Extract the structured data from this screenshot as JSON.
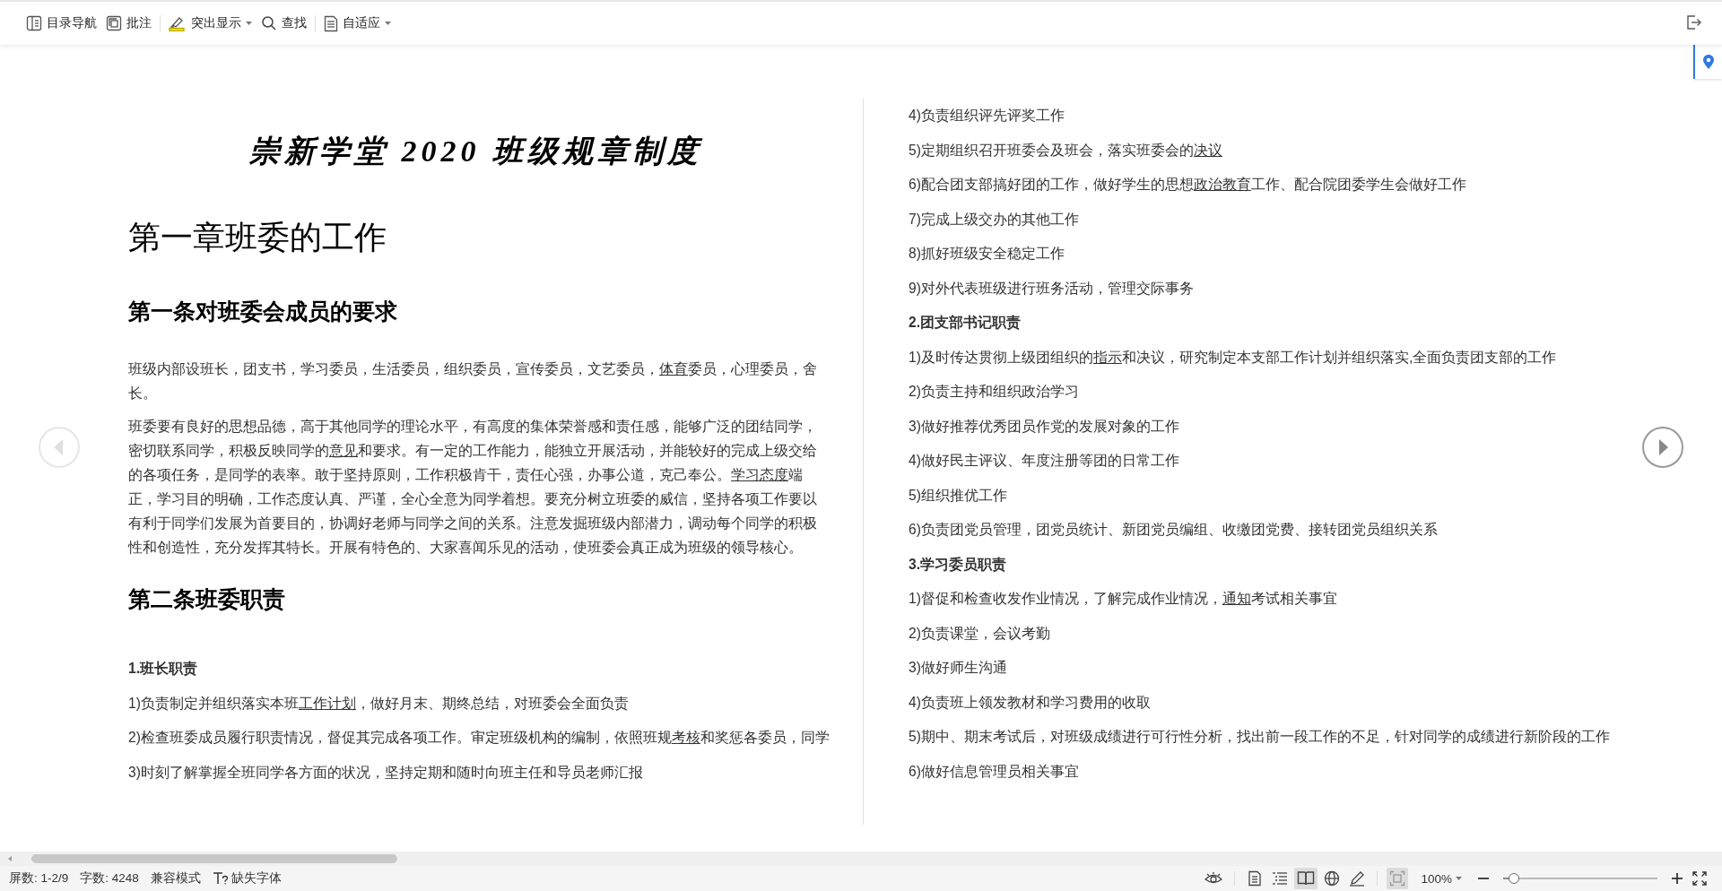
{
  "toolbar": {
    "groups": [
      [
        {
          "kind": "nav",
          "label": "目录导航",
          "dropdown": false
        },
        {
          "kind": "comment",
          "label": "批注",
          "dropdown": false
        }
      ],
      [
        {
          "kind": "highlight",
          "label": "突出显示",
          "dropdown": true
        },
        {
          "kind": "search",
          "label": "查找",
          "dropdown": false
        }
      ],
      [
        {
          "kind": "fit",
          "label": "自适应",
          "dropdown": true
        }
      ]
    ]
  },
  "left_page": {
    "blocks": [
      {
        "kind": "title",
        "runs": [
          {
            "text": "崇新学堂 2020 班级规章制度",
            "underline": false
          }
        ]
      },
      {
        "kind": "chapter",
        "runs": [
          {
            "text": "第一章班委的工作",
            "underline": false
          }
        ]
      },
      {
        "kind": "section",
        "runs": [
          {
            "text": "第一条对班委会成员的要求",
            "underline": false
          }
        ]
      },
      {
        "kind": "para",
        "runs": [
          {
            "text": "班级内部设班长，团支书，学习委员，生活委员，组织委员，宣传委员，文艺委员，",
            "underline": false
          },
          {
            "text": "体育",
            "underline": true
          },
          {
            "text": "委员，心理委员，舍长。",
            "underline": false
          }
        ]
      },
      {
        "kind": "para",
        "runs": [
          {
            "text": "班委要有良好的思想品德，高于其他同学的理论水平，有高度的集体荣誉感和责任感，能够广泛的团结同学，密切联系同学，积极反映同学的",
            "underline": false
          },
          {
            "text": "意见",
            "underline": true
          },
          {
            "text": "和要求。有一定的工作能力，能独立开展活动，并能较好的完成上级交给的各项任务，是同学的表率。敢于坚持原则，工作积极肯干，责任心强，办事公道，克己奉公。",
            "underline": false
          },
          {
            "text": "学习态度",
            "underline": true
          },
          {
            "text": "端正，学习目的明确，工作态度认真、严谨，全心全意为同学着想。要充分树立班委的威信，坚持各项工作要以有利于同学们发展为首要目的，协调好老师与同学之间的关系。注意发掘班级内部潜力，调动每个同学的积极性和创造性，充分发挥其特长。开展有特色的、大家喜闻乐见的活动，使班委会真正成为班级的领导核心。",
            "underline": false
          }
        ]
      },
      {
        "kind": "section",
        "runs": [
          {
            "text": "第二条班委职责",
            "underline": false
          }
        ]
      },
      {
        "kind": "subhead",
        "runs": [
          {
            "text": "1.班长职责",
            "underline": false
          }
        ]
      },
      {
        "kind": "item",
        "runs": [
          {
            "text": "1)负责制定并组织落实本班",
            "underline": false
          },
          {
            "text": "工作计划",
            "underline": true
          },
          {
            "text": "，做好月末、期终总结，对班委会全面负责",
            "underline": false
          }
        ]
      },
      {
        "kind": "item",
        "runs": [
          {
            "text": "2)检查班委成员履行职责情况，督促其完成各项工作。审定班级机构的编制，依照班规",
            "underline": false
          },
          {
            "text": "考核",
            "underline": true
          },
          {
            "text": "和奖惩各委员，同学",
            "underline": false
          }
        ]
      },
      {
        "kind": "item",
        "runs": [
          {
            "text": "3)时刻了解掌握全班同学各方面的状况，坚持定期和随时向班主任和导员老师汇报",
            "underline": false
          }
        ]
      }
    ]
  },
  "right_page": {
    "blocks": [
      {
        "kind": "item",
        "runs": [
          {
            "text": "4)负责组织评先评奖工作",
            "underline": false
          }
        ]
      },
      {
        "kind": "item",
        "runs": [
          {
            "text": "5)定期组织召开班委会及班会，落实班委会的",
            "underline": false
          },
          {
            "text": "决议",
            "underline": true
          }
        ]
      },
      {
        "kind": "item",
        "runs": [
          {
            "text": "6)配合团支部搞好团的工作，做好学生的思想",
            "underline": false
          },
          {
            "text": "政治教育",
            "underline": true
          },
          {
            "text": "工作、配合院团委学生会做好工作",
            "underline": false
          }
        ]
      },
      {
        "kind": "item",
        "runs": [
          {
            "text": "7)完成上级交办的其他工作",
            "underline": false
          }
        ]
      },
      {
        "kind": "item",
        "runs": [
          {
            "text": "8)抓好班级安全稳定工作",
            "underline": false
          }
        ]
      },
      {
        "kind": "item",
        "runs": [
          {
            "text": "9)对外代表班级进行班务活动，管理交际事务",
            "underline": false
          }
        ]
      },
      {
        "kind": "subhead",
        "runs": [
          {
            "text": "2.团支部书记职责",
            "underline": false
          }
        ]
      },
      {
        "kind": "item",
        "runs": [
          {
            "text": "1)及时传达贯彻上级团组织的",
            "underline": false
          },
          {
            "text": "指示",
            "underline": true
          },
          {
            "text": "和决议，研究制定本支部工作计划并组织落实,全面负责团支部的工作",
            "underline": false
          }
        ]
      },
      {
        "kind": "item",
        "runs": [
          {
            "text": "2)负责主持和组织政治学习",
            "underline": false
          }
        ]
      },
      {
        "kind": "item",
        "runs": [
          {
            "text": "3)做好推荐优秀团员作党的发展对象的工作",
            "underline": false
          }
        ]
      },
      {
        "kind": "item",
        "runs": [
          {
            "text": "4)做好民主评议、年度注册等团的日常工作",
            "underline": false
          }
        ]
      },
      {
        "kind": "item",
        "runs": [
          {
            "text": "5)组织推优工作",
            "underline": false
          }
        ]
      },
      {
        "kind": "item",
        "runs": [
          {
            "text": "6)负责团党员管理，团党员统计、新团党员编组、收缴团党费、接转团党员组织关系",
            "underline": false
          }
        ]
      },
      {
        "kind": "subhead",
        "runs": [
          {
            "text": "3.学习委员职责",
            "underline": false
          }
        ]
      },
      {
        "kind": "item",
        "runs": [
          {
            "text": "1)督促和检查收发作业情况，了解完成作业情况，",
            "underline": false
          },
          {
            "text": "通知",
            "underline": true
          },
          {
            "text": "考试相关事宜",
            "underline": false
          }
        ]
      },
      {
        "kind": "item",
        "runs": [
          {
            "text": "2)负责课堂，会议考勤",
            "underline": false
          }
        ]
      },
      {
        "kind": "item",
        "runs": [
          {
            "text": "3)做好师生沟通",
            "underline": false
          }
        ]
      },
      {
        "kind": "item",
        "runs": [
          {
            "text": "4)负责班上领发教材和学习费用的收取",
            "underline": false
          }
        ]
      },
      {
        "kind": "item",
        "runs": [
          {
            "text": "5)期中、期末考试后，对班级成绩进行可行性分析，找出前一段工作的不足，针对同学的成绩进行新阶段的工作",
            "underline": false
          }
        ]
      },
      {
        "kind": "item",
        "runs": [
          {
            "text": "6)做好信息管理员相关事宜",
            "underline": false
          }
        ]
      }
    ]
  },
  "status_bar": {
    "left": [
      {
        "kind": "plain",
        "text": "屏数: 1-2/9"
      },
      {
        "kind": "plain",
        "text": "字数: 4248"
      },
      {
        "kind": "plain",
        "text": "兼容模式"
      },
      {
        "kind": "font",
        "text": "缺失字体"
      }
    ],
    "view_modes": [
      {
        "kind": "page",
        "selected": false
      },
      {
        "kind": "outline",
        "selected": false
      },
      {
        "kind": "reading",
        "selected": true
      },
      {
        "kind": "web",
        "selected": false
      },
      {
        "kind": "pen",
        "selected": false
      }
    ],
    "zoom": {
      "value": "100%",
      "level": 0.07
    }
  }
}
